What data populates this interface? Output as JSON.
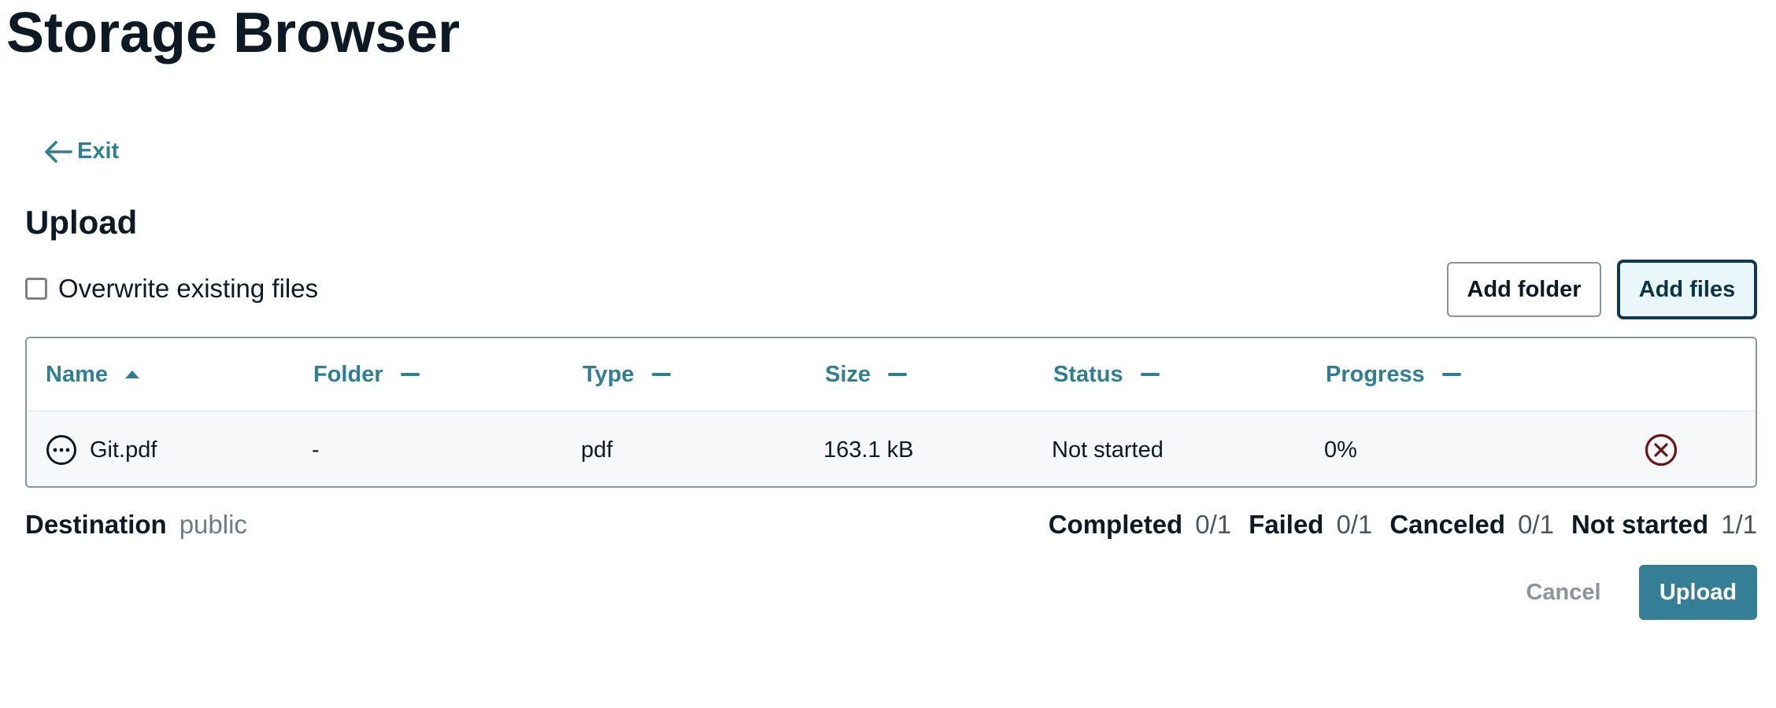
{
  "page": {
    "title": "Storage Browser"
  },
  "nav": {
    "exit_label": "Exit"
  },
  "upload": {
    "title": "Upload",
    "overwrite_label": "Overwrite existing files",
    "overwrite_checked": false,
    "add_folder_label": "Add folder",
    "add_files_label": "Add files"
  },
  "table": {
    "columns": [
      "Name",
      "Folder",
      "Type",
      "Size",
      "Status",
      "Progress"
    ],
    "sort": {
      "column": "Name",
      "direction": "ascending"
    },
    "rows": [
      {
        "status_icon": "more-horizontal-circle-icon",
        "name": "Git.pdf",
        "folder": "-",
        "type": "pdf",
        "size": "163.1 kB",
        "status": "Not started",
        "progress": "0%",
        "action_icon": "cancel-circle-icon"
      }
    ]
  },
  "footer": {
    "destination_label": "Destination",
    "destination_value": "public",
    "counts": [
      {
        "label": "Completed",
        "value": "0/1"
      },
      {
        "label": "Failed",
        "value": "0/1"
      },
      {
        "label": "Canceled",
        "value": "0/1"
      },
      {
        "label": "Not started",
        "value": "1/1"
      }
    ],
    "cancel_label": "Cancel",
    "upload_label": "Upload"
  },
  "colors": {
    "accent": "#2e7f96",
    "primary_button": "#357f96",
    "cancel_icon": "#6b1414",
    "text": "#0d1a26"
  }
}
